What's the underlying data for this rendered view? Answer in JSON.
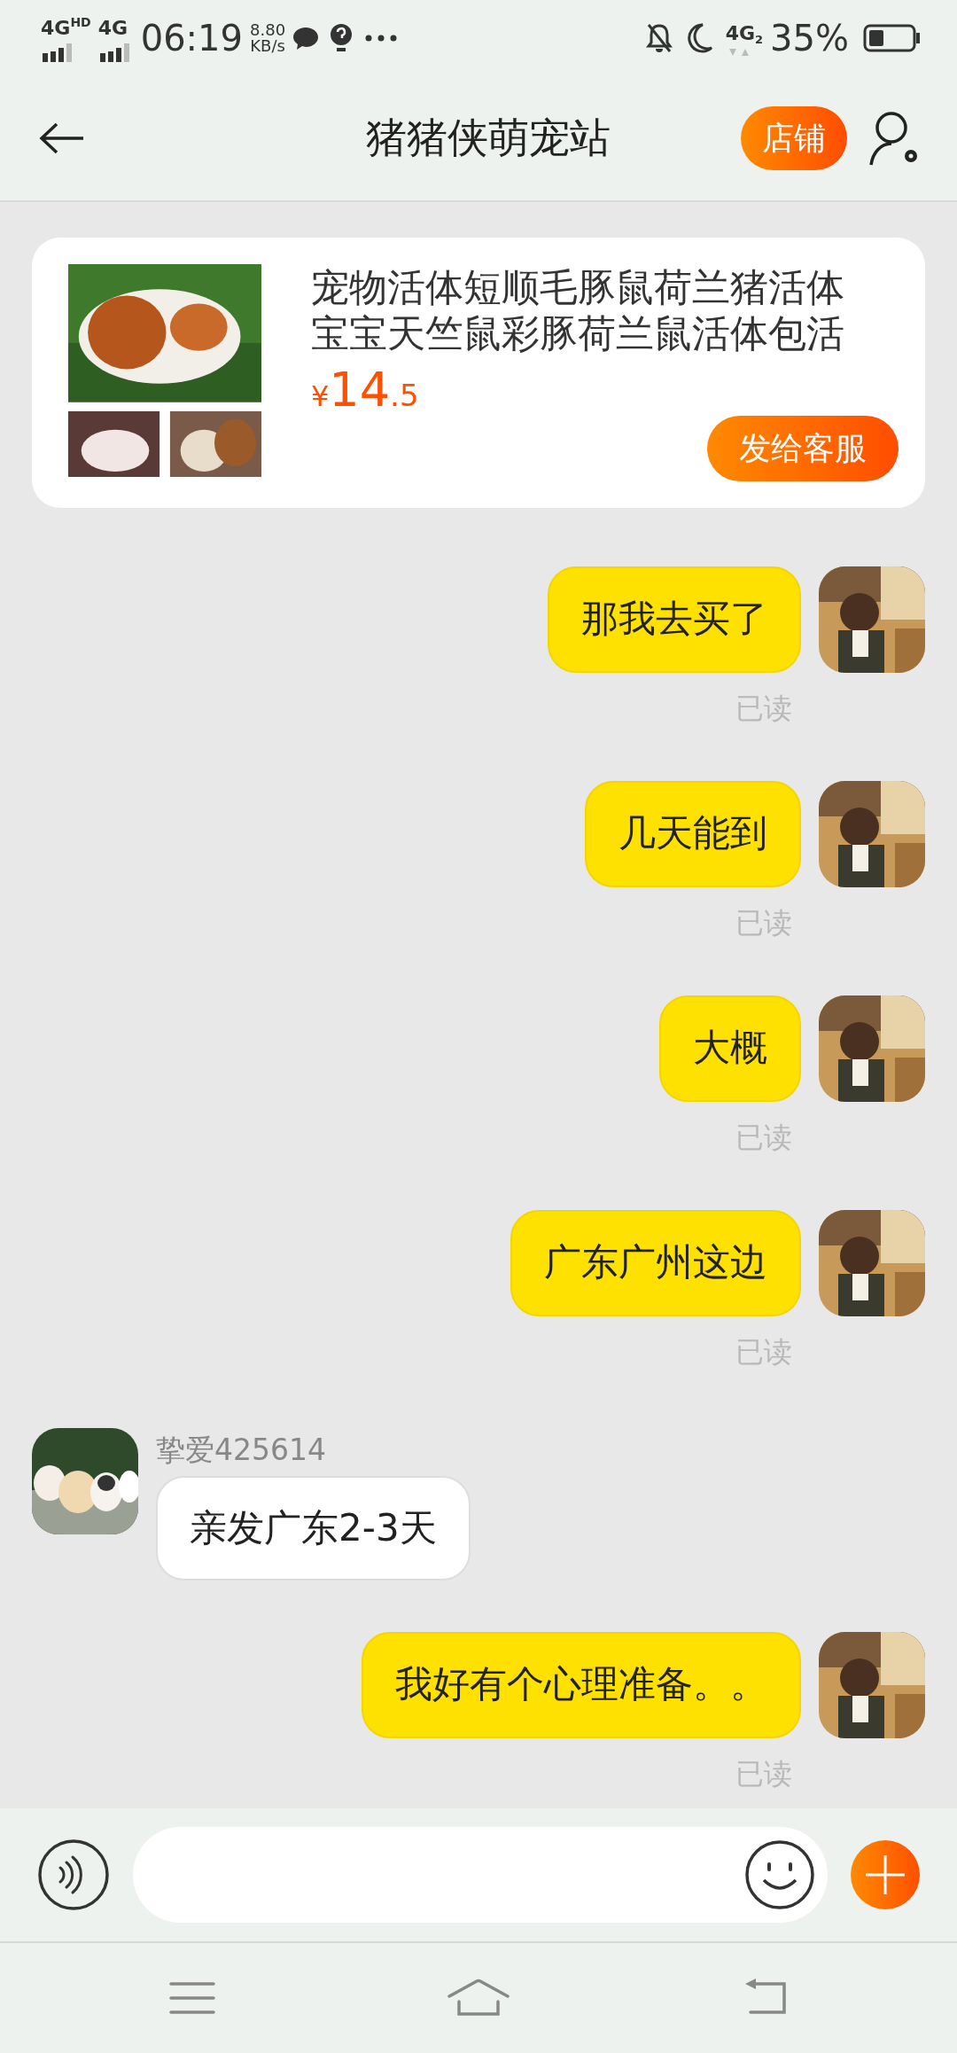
{
  "status_bar": {
    "network_1": "4G",
    "network_1_suffix": "HD",
    "network_2": "4G",
    "time": "06:19",
    "speed": "8.80",
    "speed_unit": "KB/s",
    "network_3": "4G",
    "network_3_sub": "2",
    "battery": "35%"
  },
  "header": {
    "title": "猪猪侠萌宠站",
    "shop_button": "店铺"
  },
  "product": {
    "title": "宠物活体短顺毛豚鼠荷兰猪活体宝宝天竺鼠彩豚荷兰鼠活体包活",
    "currency": "¥",
    "price_main": "14",
    "price_decimal": ".5",
    "send_button": "发给客服"
  },
  "messages": [
    {
      "kind": "sent",
      "text": "那我去买了",
      "status": "已读"
    },
    {
      "kind": "sent",
      "text": "几天能到",
      "status": "已读"
    },
    {
      "kind": "sent",
      "text": "大概",
      "status": "已读"
    },
    {
      "kind": "sent",
      "text": "广东广州这边",
      "status": "已读"
    },
    {
      "kind": "received",
      "sender": "挚爱425614",
      "text": "亲发广东2-3天"
    },
    {
      "kind": "sent",
      "text": "我好有个心理准备。。",
      "status": "已读"
    }
  ]
}
